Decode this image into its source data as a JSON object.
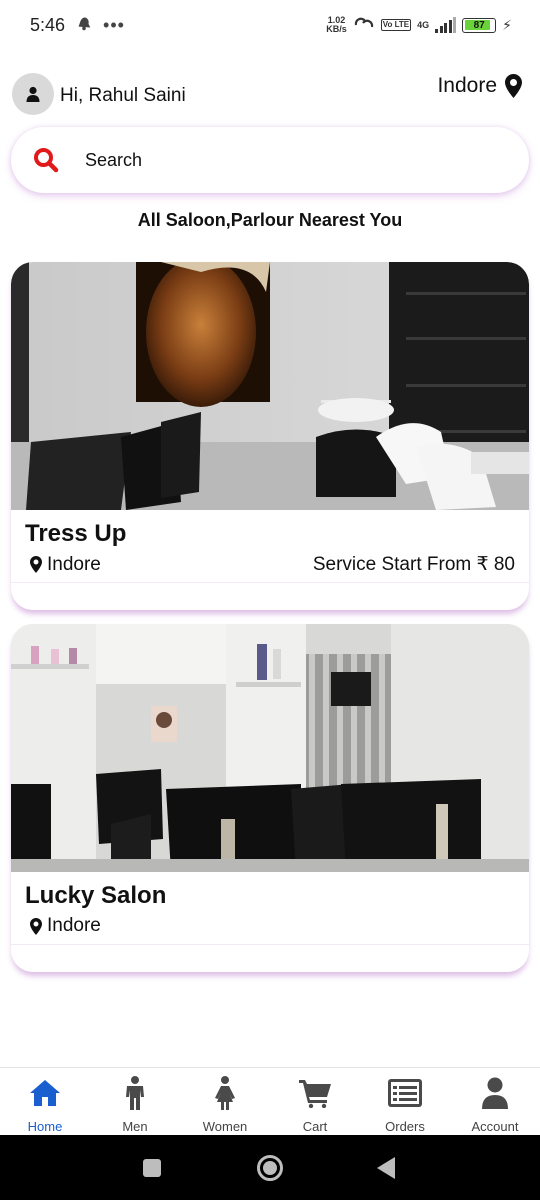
{
  "status_bar": {
    "time": "5:46",
    "net_speed_value": "1.02",
    "net_speed_unit": "KB/s",
    "volte_badge": "Vo LTE",
    "network_type": "4G",
    "battery_percent": "87",
    "battery_level": 0.87
  },
  "header": {
    "greeting": "Hi, Rahul Saini",
    "location": "Indore"
  },
  "search": {
    "placeholder": "Search"
  },
  "section_title": "All Saloon,Parlour Nearest You",
  "salons": [
    {
      "name": "Tress Up",
      "city": "Indore",
      "price_text": "Service Start From ₹ 80"
    },
    {
      "name": "Lucky Salon",
      "city": "Indore",
      "price_text": ""
    }
  ],
  "bottom_nav": {
    "items": [
      {
        "label": "Home",
        "icon": "home-icon",
        "active": true
      },
      {
        "label": "Men",
        "icon": "man-icon",
        "active": false
      },
      {
        "label": "Women",
        "icon": "woman-icon",
        "active": false
      },
      {
        "label": "Cart",
        "icon": "cart-icon",
        "active": false
      },
      {
        "label": "Orders",
        "icon": "orders-icon",
        "active": false
      },
      {
        "label": "Account",
        "icon": "account-icon",
        "active": false
      }
    ]
  },
  "colors": {
    "accent_blue": "#1a5fd0",
    "search_icon_red": "#e0191b",
    "card_shadow": "#b46ec8",
    "nav_icon": "#4a4a4a"
  }
}
